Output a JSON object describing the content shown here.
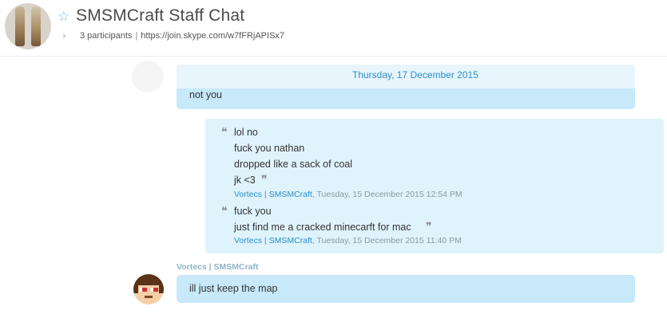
{
  "header": {
    "title": "SMSMCraft Staff Chat",
    "participants": "3 participants",
    "separator": "|",
    "join_link": "https://join.skype.com/w7fFRjAPISx7"
  },
  "chat": {
    "date_divider": "Thursday, 17 December 2015",
    "messages": [
      {
        "text": "not you"
      }
    ],
    "quotes": [
      {
        "lines": [
          "lol no",
          "fuck you nathan",
          "dropped like a sack of coal",
          "jk <3"
        ],
        "author": "Vortecs | SMSMCraft",
        "timestamp": ", Tuesday, 15 December 2015 12:54 PM"
      },
      {
        "lines": [
          "fuck you",
          "just find me a cracked minecarft for mac"
        ],
        "author": "Vortecs | SMSMCraft",
        "timestamp": ", Tuesday, 15 December 2015 11:40 PM"
      }
    ],
    "last_sender": "Vortecs | SMSMCraft",
    "last_message": "ill just keep the map"
  },
  "colors": {
    "accent": "#2b8fca",
    "bubble": "#c7e9fa",
    "quote_bubble": "#dff3fd"
  },
  "icons": {
    "favorite": "star-outline-icon",
    "expand": "chevron-right-icon",
    "quote_open": "open-quote-icon",
    "quote_close": "close-quote-icon"
  }
}
